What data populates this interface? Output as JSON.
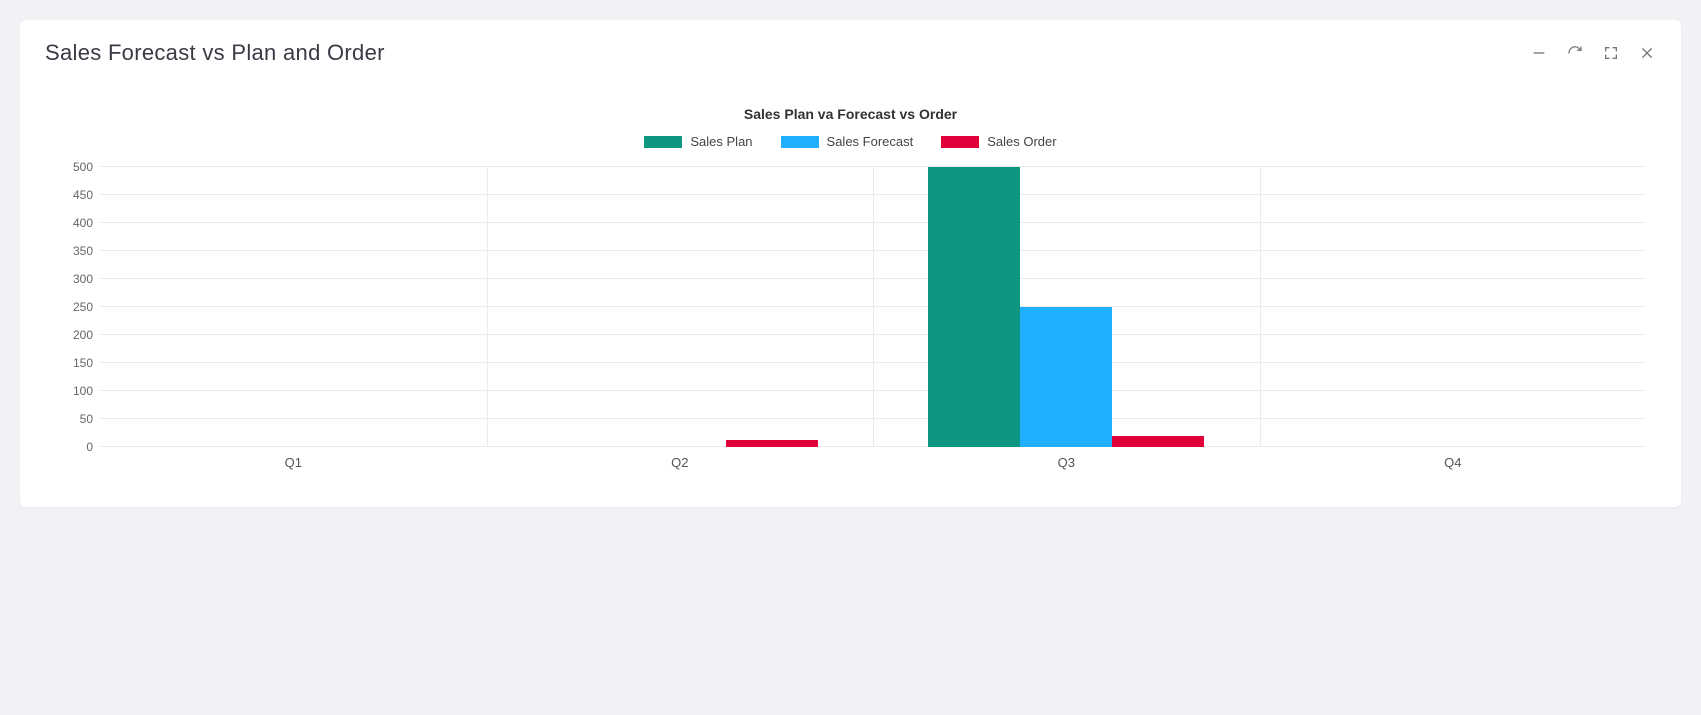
{
  "header": {
    "title": "Sales Forecast vs Plan and Order"
  },
  "colors": {
    "teal": "#0f9680",
    "blue": "#20afff",
    "red": "#e1003a"
  },
  "chart_data": {
    "type": "bar",
    "title": "Sales Plan va Forecast vs Order",
    "categories": [
      "Q1",
      "Q2",
      "Q3",
      "Q4"
    ],
    "series": [
      {
        "name": "Sales Plan",
        "color": "#0f9680",
        "values": [
          0,
          0,
          500,
          0
        ]
      },
      {
        "name": "Sales Forecast",
        "color": "#20afff",
        "values": [
          0,
          0,
          250,
          0
        ]
      },
      {
        "name": "Sales Order",
        "color": "#e1003a",
        "values": [
          0,
          12,
          20,
          0
        ]
      }
    ],
    "xlabel": "",
    "ylabel": "",
    "ylim": [
      0,
      500
    ],
    "yticks": [
      0,
      50,
      100,
      150,
      200,
      250,
      300,
      350,
      400,
      450,
      500
    ]
  }
}
